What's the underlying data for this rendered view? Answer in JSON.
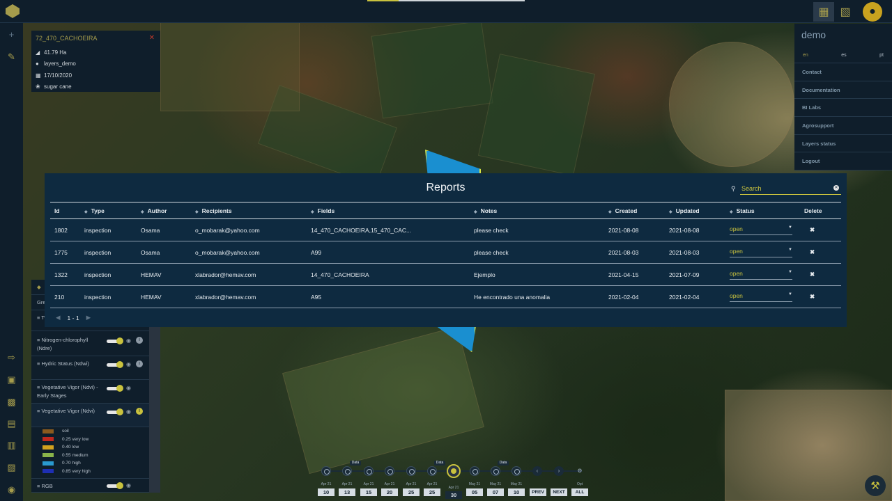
{
  "field_card": {
    "title": "72_470_CACHOEIRA",
    "area": "41.79 Ha",
    "owner": "layers_demo",
    "date": "17/10/2020",
    "crop": "sugar cane"
  },
  "layers": {
    "header_partial": "Gre",
    "items": [
      {
        "label": "Tw",
        "info": false
      },
      {
        "label": "Nitrogen-chlorophyll (Ndre)",
        "info": true
      },
      {
        "label": "Hydric Status (Ndwi)",
        "info": true
      },
      {
        "label": "Vegetative Vigor (Ndvi) - Early Stages",
        "info": false
      },
      {
        "label": "Vegetative Vigor (Ndvi)",
        "info": true,
        "info_active": true
      },
      {
        "label": "RGB",
        "info": false
      }
    ],
    "legend": [
      {
        "label": "soil",
        "color": "#8b5a1e"
      },
      {
        "label": "0.25 very low",
        "color": "#c0281e"
      },
      {
        "label": "0.40 low",
        "color": "#d2a21e"
      },
      {
        "label": "0.55 medium",
        "color": "#8ab44a"
      },
      {
        "label": "0.70 high",
        "color": "#2a9ad0"
      },
      {
        "label": "0.85 very high",
        "color": "#1e2fb4"
      }
    ]
  },
  "right_menu": {
    "user": "demo",
    "languages": [
      "en",
      "es",
      "pt"
    ],
    "items": [
      "Contact",
      "Documentation",
      "BI Labs",
      "Agrosupport",
      "Layers status",
      "Logout"
    ]
  },
  "reports": {
    "title": "Reports",
    "search_placeholder": "Search",
    "columns": [
      "Id",
      "Type",
      "Author",
      "Recipients",
      "Fields",
      "Notes",
      "Created",
      "Updated",
      "Status",
      "Delete"
    ],
    "rows": [
      {
        "id": "1802",
        "type": "inspection",
        "author": "Osama",
        "recipients": "o_mobarak@yahoo.com",
        "fields": "14_470_CACHOEIRA,15_470_CAC...",
        "notes": "please check",
        "created": "2021-08-08",
        "updated": "2021-08-08",
        "status": "open"
      },
      {
        "id": "1775",
        "type": "inspection",
        "author": "Osama",
        "recipients": "o_mobarak@yahoo.com",
        "fields": "A99",
        "notes": "please check",
        "created": "2021-08-03",
        "updated": "2021-08-03",
        "status": "open"
      },
      {
        "id": "1322",
        "type": "inspection",
        "author": "HEMAV",
        "recipients": "xlabrador@hemav.com",
        "fields": "14_470_CACHOEIRA",
        "notes": "Ejemplo",
        "created": "2021-04-15",
        "updated": "2021-07-09",
        "status": "open"
      },
      {
        "id": "210",
        "type": "inspection",
        "author": "HEMAV",
        "recipients": "xlabrador@hemav.com",
        "fields": "A95",
        "notes": "He encontrado una anomalia",
        "created": "2021-02-04",
        "updated": "2021-02-04",
        "status": "open"
      }
    ],
    "pagination": "1 - 1"
  },
  "timeline": {
    "badge_label": "Data",
    "dates": [
      {
        "month": "Apr 21",
        "day": "10"
      },
      {
        "month": "Apr 21",
        "day": "13"
      },
      {
        "month": "Apr 21",
        "day": "15"
      },
      {
        "month": "Apr 21",
        "day": "20"
      },
      {
        "month": "Apr 21",
        "day": "25"
      },
      {
        "month": "Apr 21",
        "day": "25"
      },
      {
        "month": "Apr 21",
        "day": "30"
      },
      {
        "month": "May 21",
        "day": "05"
      },
      {
        "month": "May 21",
        "day": "07"
      },
      {
        "month": "May 21",
        "day": "10"
      }
    ],
    "prev": "PREV",
    "next": "NEXT",
    "all": "ALL",
    "opt_label": "Opt"
  }
}
